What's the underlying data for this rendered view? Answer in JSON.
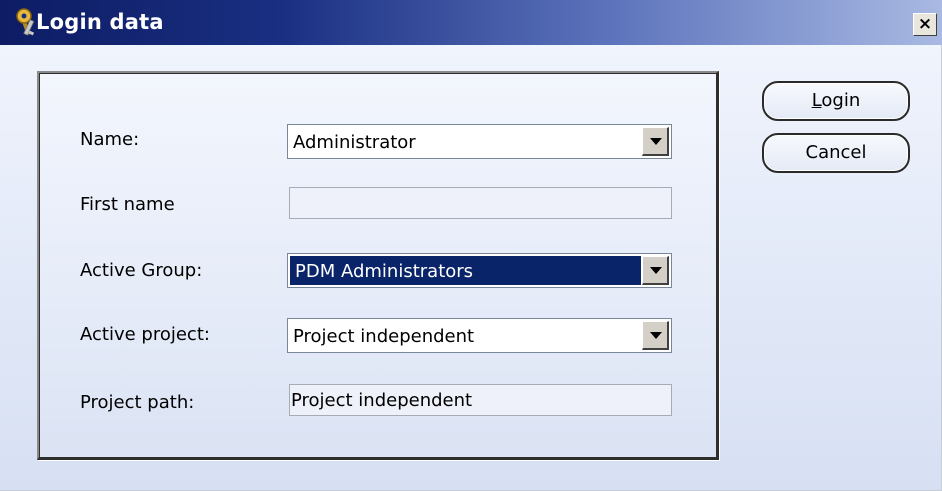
{
  "window": {
    "title": "Login data",
    "icon": "keys-icon",
    "close_glyph": "×"
  },
  "form": {
    "name": {
      "label": "Name:",
      "value": "Administrator"
    },
    "first_name": {
      "label": "First name",
      "value": ""
    },
    "active_group": {
      "label": "Active Group:",
      "value": "PDM Administrators"
    },
    "active_project": {
      "label": "Active project:",
      "value": "Project independent"
    },
    "project_path": {
      "label": "Project path:",
      "value": "Project independent"
    }
  },
  "buttons": {
    "login": {
      "accel": "L",
      "rest": "ogin"
    },
    "cancel": {
      "label": "Cancel"
    }
  },
  "colors": {
    "title_start": "#0d1c64",
    "title_end": "#a9b9e3",
    "selection": "#0a246a",
    "dialog_bg": "#e2e9f8"
  }
}
